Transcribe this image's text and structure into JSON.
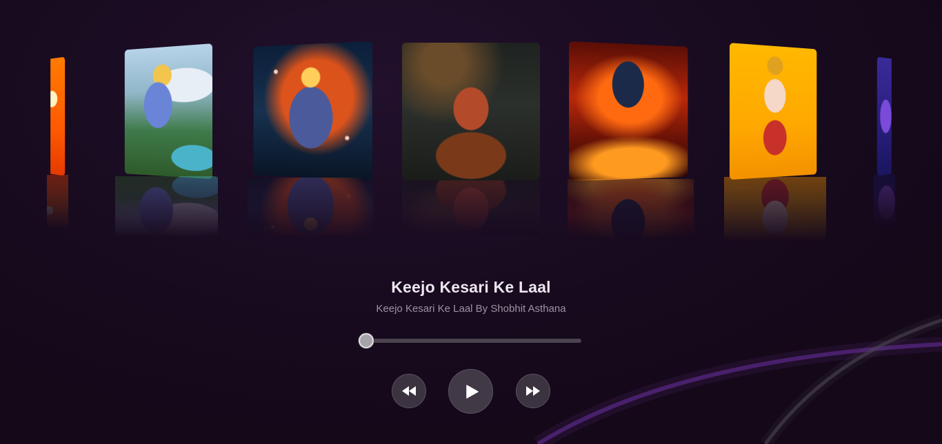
{
  "player": {
    "track_title": "Keejo Kesari Ke Laal",
    "track_subtitle": "Keejo Kesari Ke Laal By Shobhit Asthana",
    "progress_fraction": 0.0
  },
  "carousel": {
    "cards": [
      {
        "art": "sunset-silhouette-art"
      },
      {
        "art": "krishna-flute-art"
      },
      {
        "art": "ram-bow-art"
      },
      {
        "art": "hanuman-meditating-art",
        "active": true
      },
      {
        "art": "shiva-fire-art"
      },
      {
        "art": "ganesh-art"
      },
      {
        "art": "blue-deity-art"
      }
    ]
  },
  "controls": {
    "previous_icon": "rewind-icon",
    "play_icon": "play-icon",
    "next_icon": "fast-forward-icon"
  },
  "colors": {
    "background": "#170a1e",
    "title": "#ece7ef",
    "subtitle": "#9c93a3",
    "accent_arc": "#7a3bb0"
  }
}
